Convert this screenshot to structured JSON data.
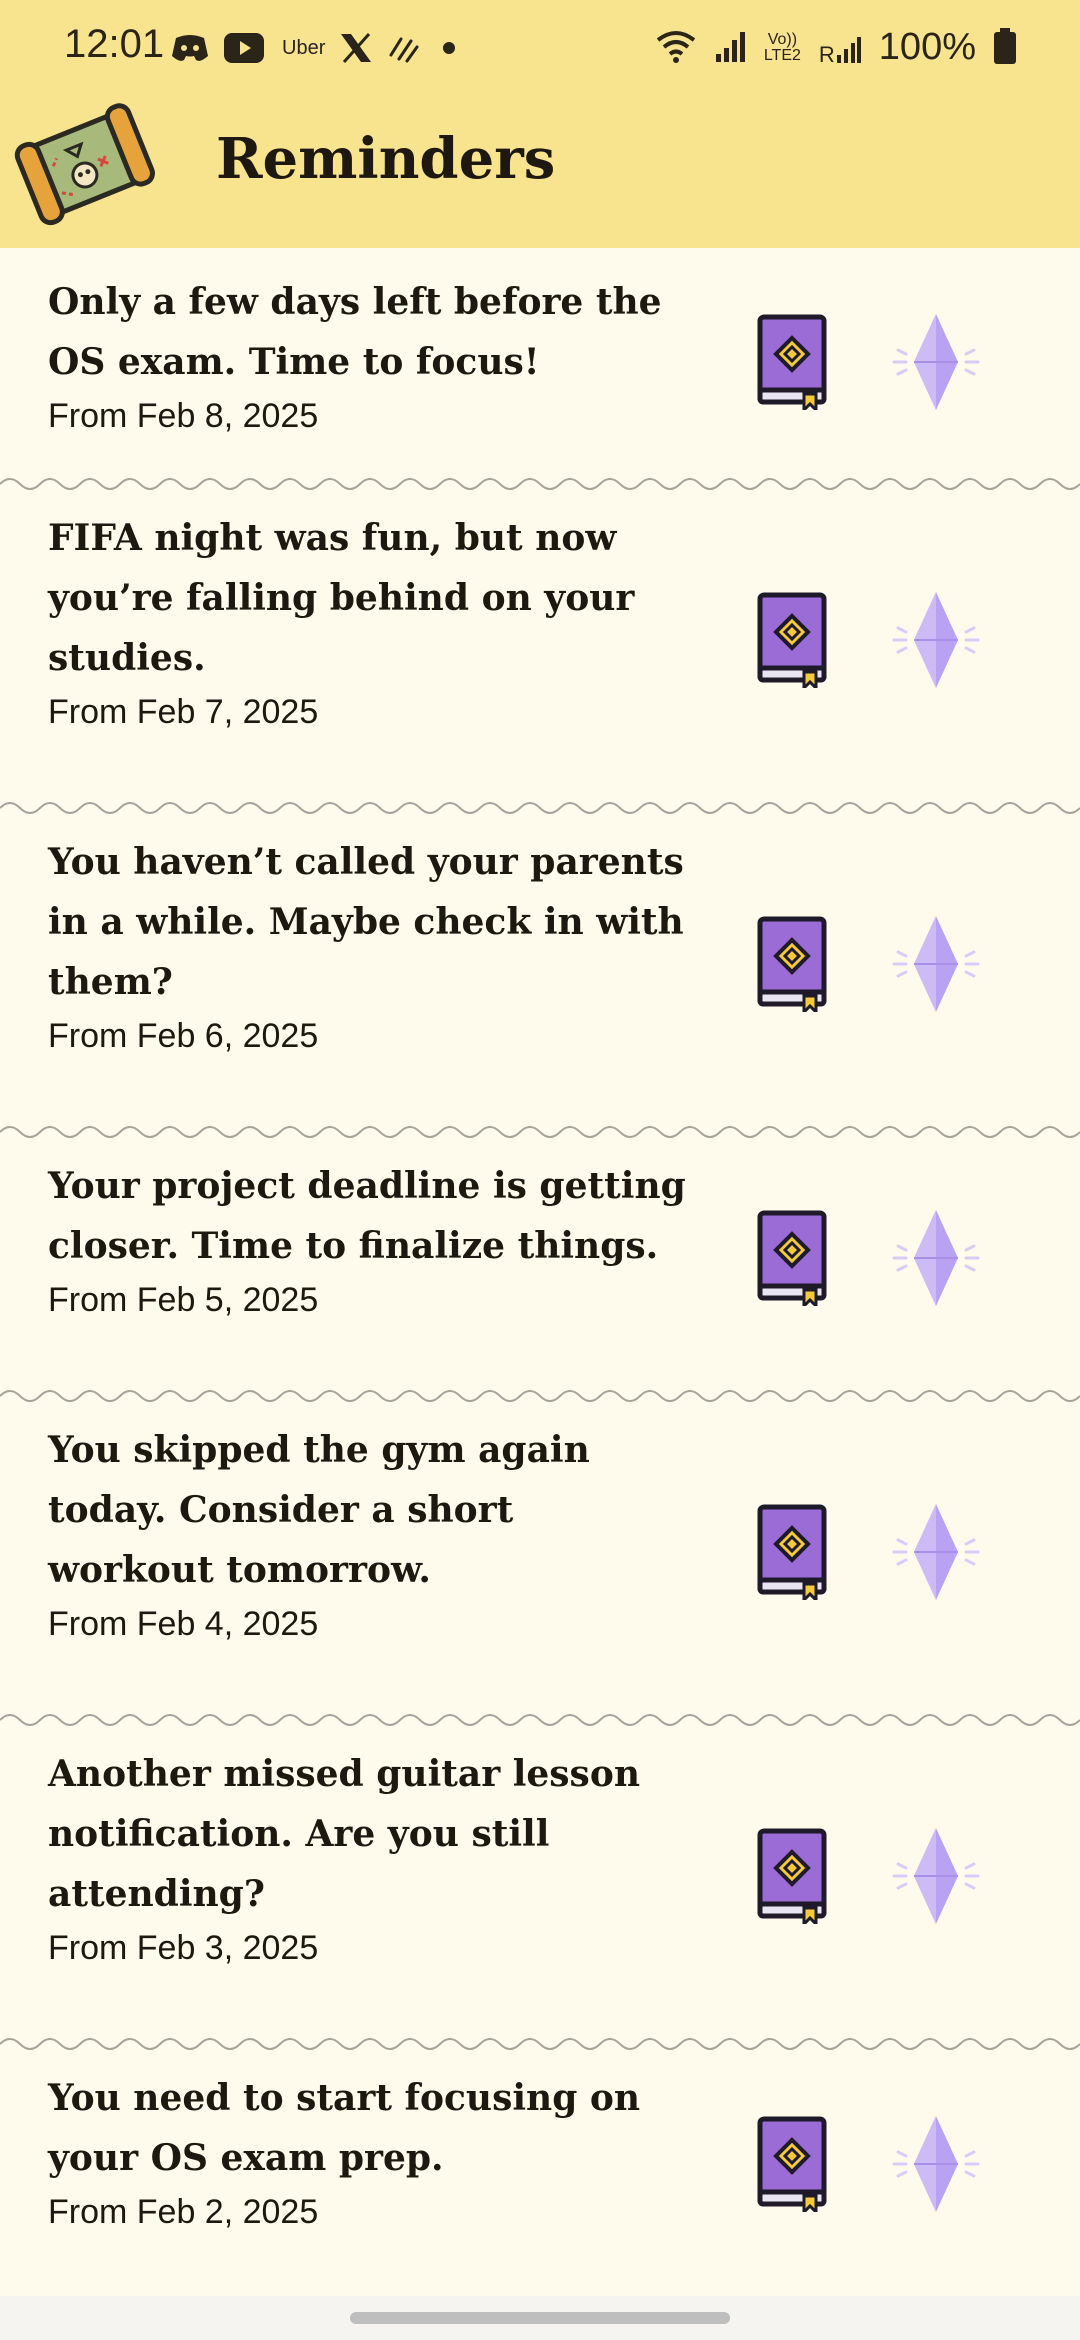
{
  "status_bar": {
    "time": "12:01",
    "app_icons": [
      "discord-icon",
      "youtube-icon",
      "uber-icon",
      "x-icon",
      "strava-icon"
    ],
    "uber_label": "Uber",
    "network_label_1": "Vo))",
    "network_label_2": "LTE2",
    "roaming_label": "R",
    "battery": "100%"
  },
  "header": {
    "title": "Reminders",
    "background": "#F8E38F"
  },
  "reminders": [
    {
      "message": "Only a few days left before the OS exam. Time to focus!",
      "date": "From Feb 8, 2025"
    },
    {
      "message": "FIFA night was fun, but now you’re falling behind on your studies.",
      "date": "From Feb 7, 2025"
    },
    {
      "message": "You haven’t called your parents in a while. Maybe check in with them?",
      "date": "From Feb 6, 2025"
    },
    {
      "message": "Your project deadline is getting closer. Time to finalize things.",
      "date": "From Feb 5, 2025"
    },
    {
      "message": "You skipped the gym again today. Consider a short workout tomorrow.",
      "date": "From Feb 4, 2025"
    },
    {
      "message": "Another missed guitar lesson notification. Are you still attending?",
      "date": "From Feb 3, 2025"
    },
    {
      "message": "You need to start focusing on your OS exam prep.",
      "date": "From Feb 2, 2025"
    }
  ],
  "icons": {
    "book": "book-icon",
    "gem": "crystal-icon"
  },
  "colors": {
    "background": "#FEFBEC",
    "book_purple": "#9B6BD6",
    "gem_purple": "#B9A2F2"
  }
}
